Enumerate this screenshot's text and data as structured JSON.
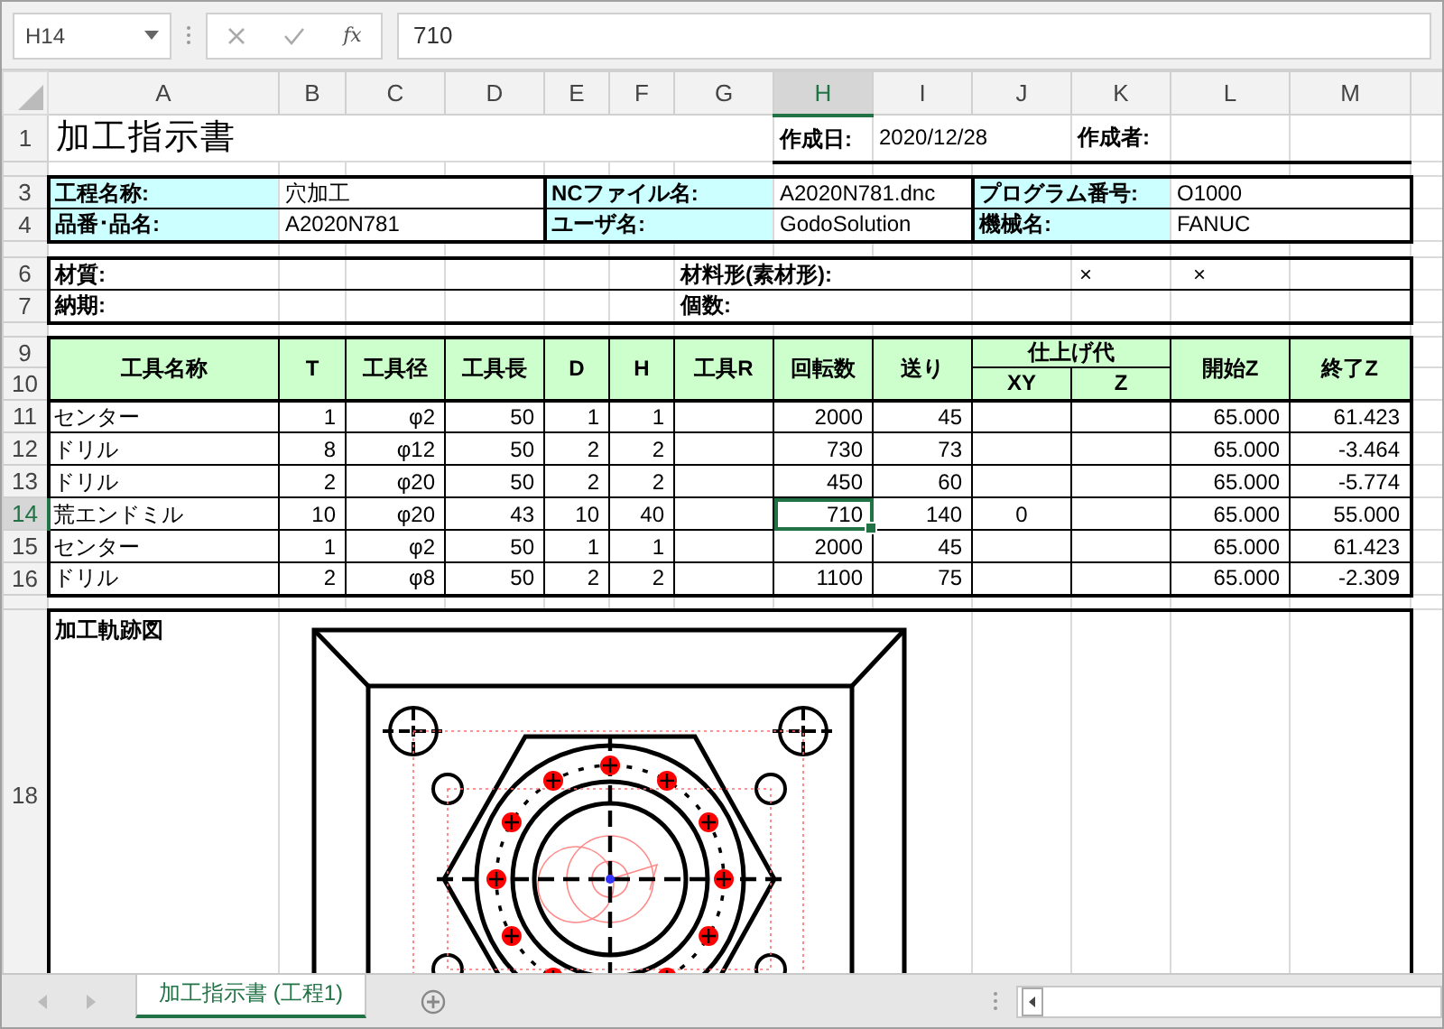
{
  "name_box": "H14",
  "function_label": "fx",
  "formula": "710",
  "columns": [
    {
      "label": "A",
      "selected": false
    },
    {
      "label": "B",
      "selected": false
    },
    {
      "label": "C",
      "selected": false
    },
    {
      "label": "D",
      "selected": false
    },
    {
      "label": "E",
      "selected": false
    },
    {
      "label": "F",
      "selected": false
    },
    {
      "label": "G",
      "selected": false
    },
    {
      "label": "H",
      "selected": true
    },
    {
      "label": "I",
      "selected": false
    },
    {
      "label": "J",
      "selected": false
    },
    {
      "label": "K",
      "selected": false
    },
    {
      "label": "L",
      "selected": false
    },
    {
      "label": "M",
      "selected": false
    }
  ],
  "row_headers": [
    {
      "label": "1",
      "selected": false
    },
    {
      "label": "3",
      "selected": false
    },
    {
      "label": "4",
      "selected": false
    },
    {
      "label": "6",
      "selected": false
    },
    {
      "label": "7",
      "selected": false
    },
    {
      "label": "9",
      "selected": false
    },
    {
      "label": "10",
      "selected": false
    },
    {
      "label": "11",
      "selected": false
    },
    {
      "label": "12",
      "selected": false
    },
    {
      "label": "13",
      "selected": false
    },
    {
      "label": "14",
      "selected": true
    },
    {
      "label": "15",
      "selected": false
    },
    {
      "label": "16",
      "selected": false
    },
    {
      "label": "18",
      "selected": false
    }
  ],
  "header": {
    "title": "加工指示書",
    "created_label": "作成日:",
    "created_date": "2020/12/28",
    "author_label": "作成者:"
  },
  "info_rows": [
    [
      {
        "label": "工程名称:",
        "value": "穴加工"
      },
      {
        "label": "NCファイル名:",
        "value": "A2020N781.dnc"
      },
      {
        "label": "プログラム番号:",
        "value": "O1000"
      }
    ],
    [
      {
        "label": "品番･品名:",
        "value": "A2020N781"
      },
      {
        "label": "ユーザ名:",
        "value": "GodoSolution"
      },
      {
        "label": "機械名:",
        "value": "FANUC"
      }
    ]
  ],
  "spec_rows": [
    {
      "label": "材質:",
      "shape_label": "材料形(素材形):",
      "marks": [
        "×",
        "×"
      ]
    },
    {
      "label": "納期:",
      "shape_label": "個数:"
    }
  ],
  "tool_table": {
    "columns": [
      "工具名称",
      "T",
      "工具径",
      "工具長",
      "D",
      "H",
      "工具R",
      "回転数",
      "送り"
    ],
    "allowance": {
      "label": "仕上げ代",
      "sub": [
        "XY",
        "Z"
      ]
    },
    "columns_end": [
      "開始Z",
      "終了Z"
    ],
    "rows": [
      {
        "name": "センター",
        "t": "1",
        "diameter": "φ2",
        "length": "50",
        "d": "1",
        "h": "1",
        "rpm": "2000",
        "feed": "45",
        "start_z": "65.000",
        "end_z": "61.423"
      },
      {
        "name": "ドリル",
        "t": "8",
        "diameter": "φ12",
        "length": "50",
        "d": "2",
        "h": "2",
        "rpm": "730",
        "feed": "73",
        "start_z": "65.000",
        "end_z": "-3.464"
      },
      {
        "name": "ドリル",
        "t": "2",
        "diameter": "φ20",
        "length": "50",
        "d": "2",
        "h": "2",
        "rpm": "450",
        "feed": "60",
        "start_z": "65.000",
        "end_z": "-5.774"
      },
      {
        "name": "荒エンドミル",
        "t": "10",
        "diameter": "φ20",
        "length": "43",
        "d": "10",
        "h": "40",
        "rpm": "710",
        "feed": "140",
        "allowance_xy": "0",
        "start_z": "65.000",
        "end_z": "55.000"
      },
      {
        "name": "センター",
        "t": "1",
        "diameter": "φ2",
        "length": "50",
        "d": "1",
        "h": "1",
        "rpm": "2000",
        "feed": "45",
        "start_z": "65.000",
        "end_z": "61.423"
      },
      {
        "name": "ドリル",
        "t": "2",
        "diameter": "φ8",
        "length": "50",
        "d": "2",
        "h": "2",
        "rpm": "1100",
        "feed": "75",
        "start_z": "65.000",
        "end_z": "-2.309"
      }
    ]
  },
  "drawing_label": "加工軌跡図",
  "sheet_tabs": [
    {
      "label": "加工指示書 (工程1)",
      "selected": true
    }
  ]
}
